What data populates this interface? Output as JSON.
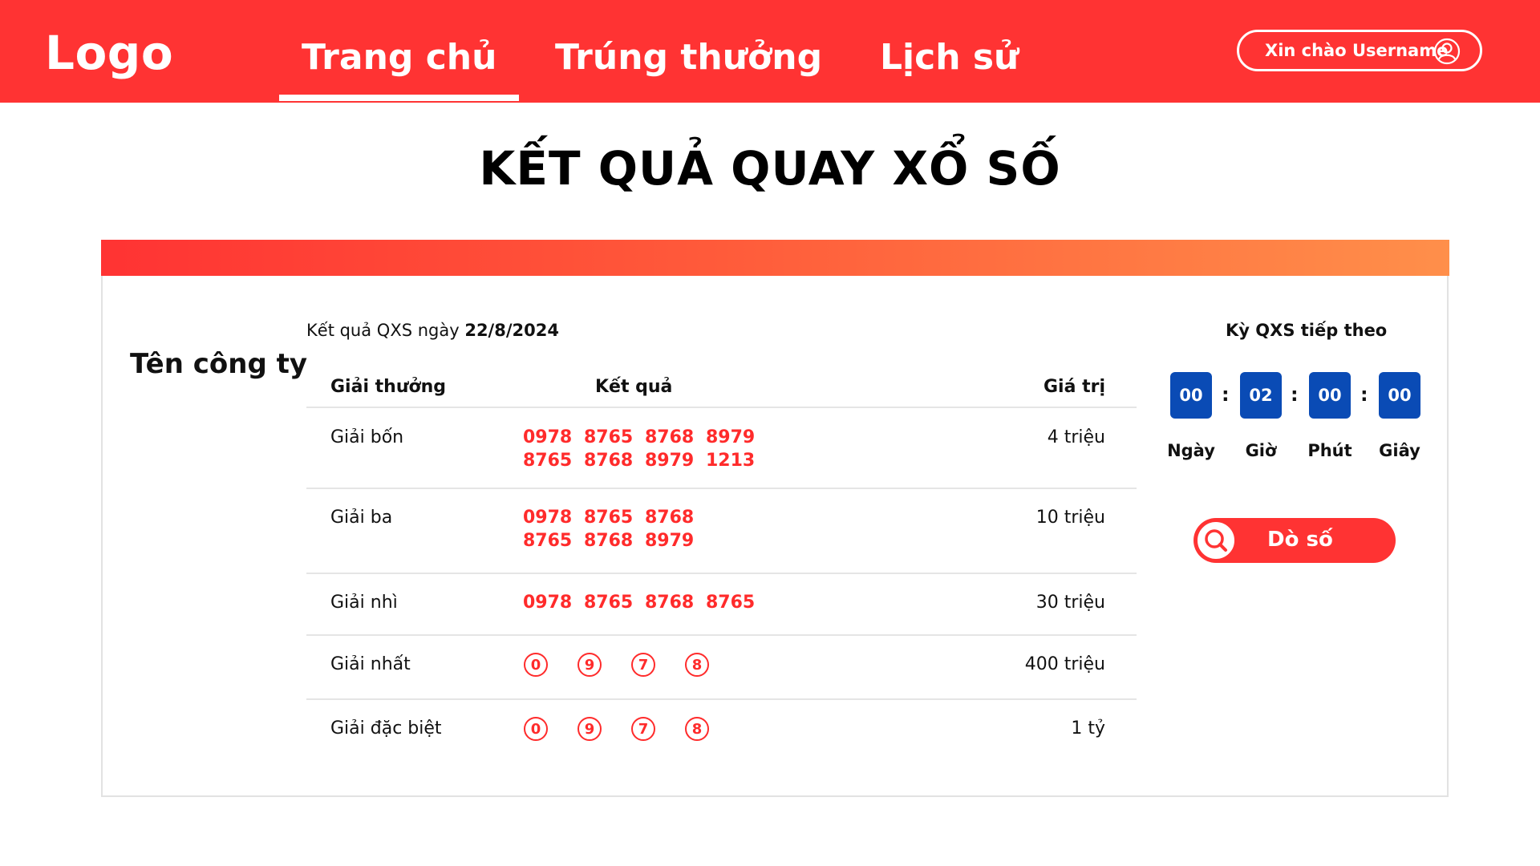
{
  "header": {
    "logo": "Logo",
    "nav": [
      "Trang chủ",
      "Trúng thưởng",
      "Lịch sử"
    ],
    "greeting": "Xin chào Username"
  },
  "page": {
    "title": "KẾT QUẢ QUAY XỔ SỐ",
    "company": "Tên công ty",
    "date_prefix": "Kết quả QXS ngày ",
    "date": "22/8/2024"
  },
  "table": {
    "headers": [
      "Giải thưởng",
      "Kết quả",
      "Giá trị"
    ],
    "rows": [
      {
        "name": "Giải bốn",
        "value": "4 triệu",
        "numbers": [
          "0978",
          "8765",
          "8768",
          "8979",
          "8765",
          "8768",
          "8979",
          "1213"
        ]
      },
      {
        "name": "Giải ba",
        "value": "10 triệu",
        "numbers": [
          "0978",
          "8765",
          "8768",
          "8765",
          "8768",
          "8979"
        ]
      },
      {
        "name": "Giải nhì",
        "value": "30 triệu",
        "numbers": [
          "0978",
          "8765",
          "8768",
          "8765"
        ]
      },
      {
        "name": "Giải nhất",
        "value": "400 triệu",
        "digits": [
          "0",
          "9",
          "7",
          "8"
        ]
      },
      {
        "name": "Giải đặc biệt",
        "value": "1 tỷ",
        "digits": [
          "0",
          "9",
          "7",
          "8"
        ]
      }
    ]
  },
  "countdown": {
    "label": "Kỳ QXS tiếp theo",
    "values": [
      "00",
      "02",
      "00",
      "00"
    ],
    "units": [
      "Ngày",
      "Giờ",
      "Phút",
      "Giây"
    ],
    "separator": ":"
  },
  "actions": {
    "search_label": "Dò số"
  },
  "colors": {
    "primary": "#ff3333",
    "number_red": "#ff2b2b",
    "countdown_blue": "#0a4bb5",
    "gradient_end": "#ff8f4a"
  },
  "icons": {
    "user": "user-circle-icon",
    "search": "search-icon"
  }
}
